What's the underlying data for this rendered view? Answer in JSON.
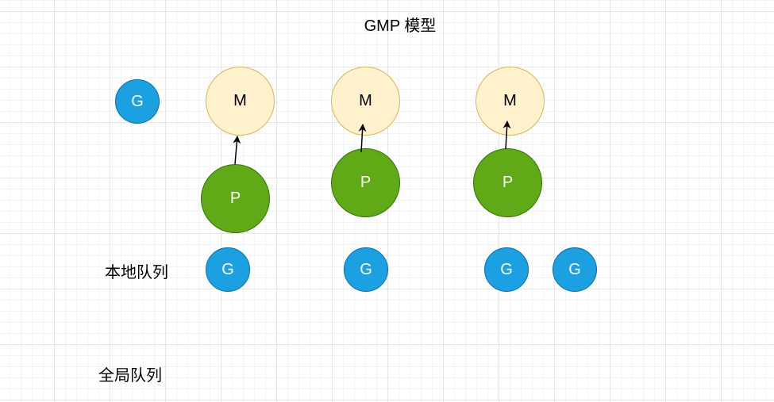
{
  "title": "GMP 模型",
  "labels": {
    "local_queue": "本地队列",
    "global_queue": "全局队列"
  },
  "nodes": {
    "g_idle": "G",
    "m1": "M",
    "m2": "M",
    "m3": "M",
    "p1": "P",
    "p2": "P",
    "p3": "P",
    "g_local_1": "G",
    "g_local_2": "G",
    "g_local_3": "G",
    "g_local_4": "G"
  },
  "colors": {
    "g_fill": "#1ba1e2",
    "g_stroke": "#006eaf",
    "m_fill": "#fff2cc",
    "m_stroke": "#d6b656",
    "p_fill": "#60a917",
    "p_stroke": "#2d7600"
  }
}
